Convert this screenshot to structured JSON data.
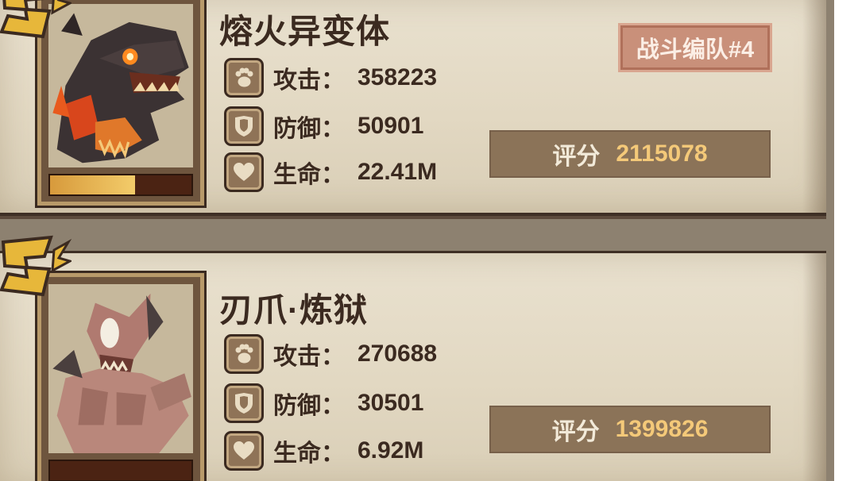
{
  "colors": {
    "panel": "#e6ddca",
    "dark_outline": "#3b2a20",
    "score_box": "#8b7358",
    "score_value": "#f4c979",
    "team_badge": "#c9907a"
  },
  "cards": [
    {
      "name": "熔火异变体",
      "rank_icon": "rank-s-icon",
      "hp_bar_fraction": 0.6,
      "team_badge": "战斗编队#4",
      "stats": [
        {
          "icon": "paw-icon",
          "label": "攻击：",
          "value": "358223"
        },
        {
          "icon": "shield-icon",
          "label": "防御：",
          "value": "50901"
        },
        {
          "icon": "heart-icon",
          "label": "生命：",
          "value": "22.41M"
        }
      ],
      "score_label": "评分",
      "score_value": "2115078"
    },
    {
      "name": "刃爪·炼狱",
      "rank_icon": "rank-s-icon",
      "hp_bar_fraction": 0.0,
      "stats": [
        {
          "icon": "paw-icon",
          "label": "攻击：",
          "value": "270688"
        },
        {
          "icon": "shield-icon",
          "label": "防御：",
          "value": "30501"
        },
        {
          "icon": "heart-icon",
          "label": "生命：",
          "value": "6.92M"
        }
      ],
      "score_label": "评分",
      "score_value": "1399826"
    }
  ]
}
